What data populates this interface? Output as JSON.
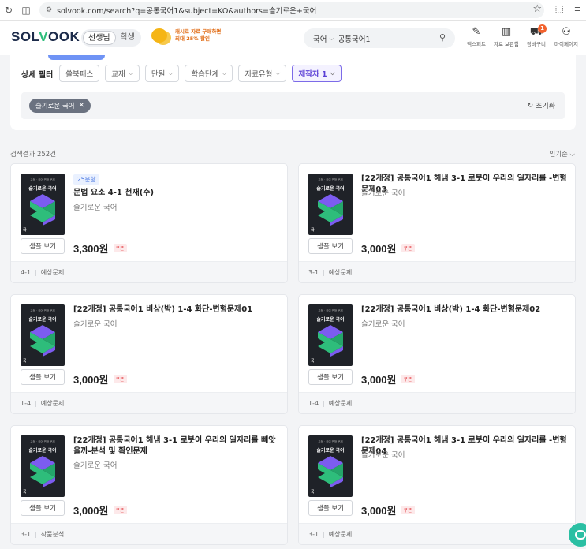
{
  "browser": {
    "url": "solvook.com/search?q=공통국어1&subject=KO&authors=슬기로운+국어",
    "reload_icon": "reload-icon",
    "sidebar_icon": "sidebar-icon"
  },
  "header": {
    "logo_prefix": "SOL",
    "logo_suffix": "OOK",
    "roles": [
      "선생님",
      "학생"
    ],
    "promo_line1": "캐시로 자료 구매하면",
    "promo_line2": "최대 25% 할인",
    "search_subject": "국어",
    "search_query": "공통국어1",
    "icons": [
      {
        "label": "엑스퍼트",
        "icon": "expert-icon"
      },
      {
        "label": "자료 보관함",
        "icon": "library-icon"
      },
      {
        "label": "장바구니",
        "icon": "cart-icon",
        "badge": "1"
      },
      {
        "label": "마이페이지",
        "icon": "user-icon"
      }
    ]
  },
  "filters": {
    "title": "상세 필터",
    "chips": [
      {
        "label": "쏠북패스",
        "dropdown": false,
        "active": false
      },
      {
        "label": "교재",
        "dropdown": true,
        "active": false
      },
      {
        "label": "단원",
        "dropdown": true,
        "active": false
      },
      {
        "label": "학습단계",
        "dropdown": true,
        "active": false
      },
      {
        "label": "자료유형",
        "dropdown": true,
        "active": false
      },
      {
        "label": "제작자 1",
        "dropdown": true,
        "active": true
      }
    ],
    "applied_tag": "슬기로운 국어",
    "reset_label": "초기화"
  },
  "results": {
    "count_label": "검색결과 252건",
    "sort_label": "인기순"
  },
  "cards": [
    {
      "badge": "25문항",
      "title": "문법 요소 4-1 천재(수)",
      "author": "슬기로운 국어",
      "price": "3,300원",
      "coupon": "쿠폰",
      "unit": "4-1",
      "type": "예상문제",
      "sample": "샘플 보기"
    },
    {
      "badge": "",
      "title": "[22개정] 공통국어1 해냄 3-1 로봇이 우리의 일자리를 -변형문제03",
      "author": "슬기로운 국어",
      "price": "3,000원",
      "coupon": "쿠폰",
      "unit": "3-1",
      "type": "예상문제",
      "sample": "샘플 보기"
    },
    {
      "badge": "",
      "title": "[22개정] 공통국어1 비상(박) 1-4 화단-변형문제01",
      "author": "슬기로운 국어",
      "price": "3,000원",
      "coupon": "쿠폰",
      "unit": "1-4",
      "type": "예상문제",
      "sample": "샘플 보기"
    },
    {
      "badge": "",
      "title": "[22개정] 공통국어1 비상(박) 1-4 화단-변형문제02",
      "author": "슬기로운 국어",
      "price": "3,000원",
      "coupon": "쿠폰",
      "unit": "1-4",
      "type": "예상문제",
      "sample": "샘플 보기"
    },
    {
      "badge": "",
      "title": "[22개정] 공통국어1 해냄 3-1 로봇이 우리의 일자리를 빼앗을까-분석 및 확인문제",
      "author": "슬기로운 국어",
      "price": "3,000원",
      "coupon": "쿠폰",
      "unit": "3-1",
      "type": "작품분석",
      "sample": "샘플 보기"
    },
    {
      "badge": "",
      "title": "[22개정] 공통국어1 해냄 3-1 로봇이 우리의 일자리를 -변형문제04",
      "author": "슬기로운 국어",
      "price": "3,000원",
      "coupon": "쿠폰",
      "unit": "3-1",
      "type": "예상문제",
      "sample": "샘플 보기"
    }
  ],
  "thumbnail": {
    "small_text": "고등 · 국어 변형 문제",
    "brand_text": "슬기로운 국어",
    "corner_text": "국"
  },
  "colors": {
    "brand_navy": "#1c2b4a",
    "brand_green": "#2ebd7b",
    "accent_purple": "#5a3fd6",
    "coupon_red": "#e3454a",
    "chat_teal": "#2bbfa3"
  }
}
